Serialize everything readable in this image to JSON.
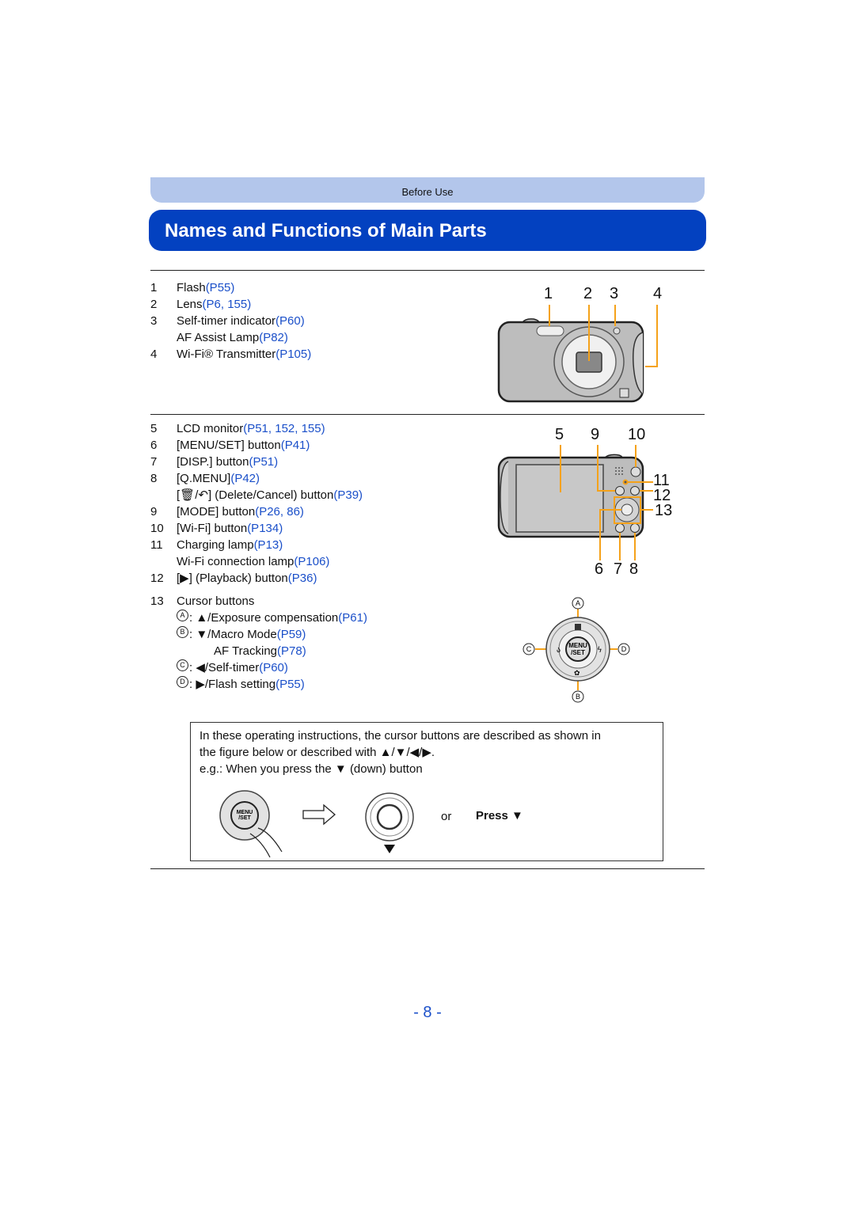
{
  "header": {
    "section": "Before Use",
    "title": "Names and Functions of Main Parts"
  },
  "front_parts": [
    {
      "num": "1",
      "label": "Flash ",
      "ref": "(P55)"
    },
    {
      "num": "2",
      "label": "Lens ",
      "ref": "(P6, 155)"
    },
    {
      "num": "3",
      "label": "Self-timer indicator ",
      "ref": "(P60)"
    },
    {
      "num": "",
      "label": "AF Assist Lamp ",
      "ref": "(P82)"
    },
    {
      "num": "4",
      "label": "Wi-Fi® Transmitter ",
      "ref": "(P105)"
    }
  ],
  "front_callouts": [
    "1",
    "2",
    "3",
    "4"
  ],
  "rear_parts": [
    {
      "num": "5",
      "label": "LCD monitor ",
      "ref": "(P51, 152, 155)"
    },
    {
      "num": "6",
      "label": "[MENU/SET] button ",
      "ref": "(P41)"
    },
    {
      "num": "7",
      "label": "[DISP.] button ",
      "ref": "(P51)"
    },
    {
      "num": "8",
      "label": "[Q.MENU] ",
      "ref": "(P42)"
    },
    {
      "num": "",
      "label": "[🗑/↶] (Delete/Cancel) button ",
      "ref": "(P39)"
    },
    {
      "num": "9",
      "label": "[MODE] button ",
      "ref": "(P26, 86)"
    },
    {
      "num": "10",
      "label": "[Wi-Fi] button ",
      "ref": "(P134)"
    },
    {
      "num": "11",
      "label": "Charging lamp ",
      "ref": "(P13)"
    },
    {
      "num": "",
      "label": "Wi-Fi connection lamp ",
      "ref": "(P106)"
    },
    {
      "num": "12",
      "label": "[▶] (Playback) button ",
      "ref": "(P36)"
    }
  ],
  "rear_callouts": {
    "top": [
      "5",
      "9",
      "10"
    ],
    "right": [
      "11",
      "12",
      "13"
    ],
    "bottom": [
      "6",
      "7",
      "8"
    ]
  },
  "cursor": {
    "num": "13",
    "heading": "Cursor buttons",
    "items": [
      {
        "letter": "A",
        "label": ": ▲/Exposure compensation ",
        "ref": "(P61)"
      },
      {
        "letter": "B",
        "label": ": ▼/Macro Mode ",
        "ref": "(P59)"
      },
      {
        "letter": "",
        "label": "AF Tracking ",
        "ref": "(P78)"
      },
      {
        "letter": "C",
        "label": ": ◀/Self-timer ",
        "ref": "(P60)"
      },
      {
        "letter": "D",
        "label": ": ▶/Flash setting ",
        "ref": "(P55)"
      }
    ],
    "dial_labels": {
      "a": "A",
      "b": "B",
      "c": "C",
      "d": "D",
      "center": "MENU /SET"
    }
  },
  "note": {
    "line1": "In these operating instructions, the cursor buttons are described as shown in",
    "line2": "the figure below or described with ▲/▼/◀/▶.",
    "line3": "e.g.: When you press the ▼ (down) button",
    "or": "or",
    "press": "Press ▼"
  },
  "page_number": "- 8 -",
  "colors": {
    "accent": "#0341c0",
    "section": "#b3c6eb",
    "link": "#1a4fc9",
    "callout_line": "#f5a21a"
  }
}
